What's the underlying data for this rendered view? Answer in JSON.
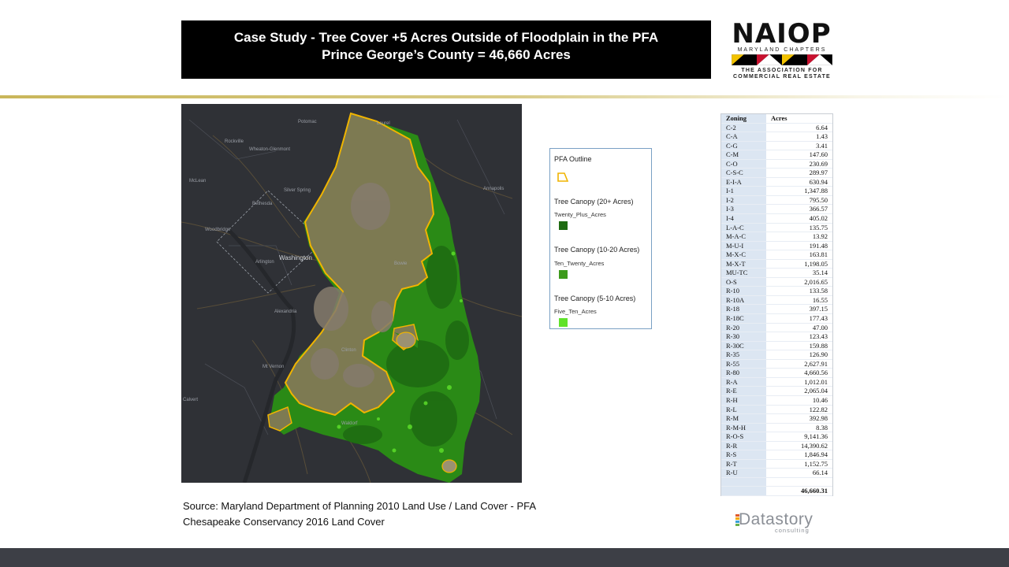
{
  "title": {
    "line1": "Case Study - Tree Cover +5 Acres Outside of Floodplain in the PFA",
    "line2": "Prince George’s County = 46,660 Acres"
  },
  "naiop_logo": {
    "name": "NAIOP",
    "chapter": "MARYLAND CHAPTERS",
    "tagline1": "THE ASSOCIATION FOR",
    "tagline2": "COMMERCIAL REAL ESTATE"
  },
  "map": {
    "labels": [
      "Washington",
      "Arlington",
      "Alexandria",
      "Bethesda",
      "Silver Spring",
      "Wheaton-Glenmont",
      "Rockville",
      "Laurel",
      "Bowie",
      "Annapolis",
      "Waldorf",
      "Clinton",
      "Mt Vernon",
      "Potomac",
      "McLean",
      "Woodbridge",
      "Calvert"
    ]
  },
  "legend": {
    "pfa_title": "PFA Outline",
    "groups": [
      {
        "heading": "Tree Canopy (20+ Acres)",
        "sub": "Twenty_Plus_Acres",
        "color": "#1e6b12"
      },
      {
        "heading": "Tree Canopy (10-20 Acres)",
        "sub": "Ten_Twenty_Acres",
        "color": "#3d9a1c"
      },
      {
        "heading": "Tree Canopy (5-10 Acres)",
        "sub": "Five_Ten_Acres",
        "color": "#5fe22a"
      }
    ],
    "pfa_outline_color": "#f0b400"
  },
  "table": {
    "headers": [
      "Zoning",
      "Acres"
    ],
    "rows": [
      {
        "zone": "C-2",
        "acres": "6.64"
      },
      {
        "zone": "C-A",
        "acres": "1.43"
      },
      {
        "zone": "C-G",
        "acres": "3.41"
      },
      {
        "zone": "C-M",
        "acres": "147.60"
      },
      {
        "zone": "C-O",
        "acres": "230.69"
      },
      {
        "zone": "C-S-C",
        "acres": "289.97"
      },
      {
        "zone": "E-I-A",
        "acres": "630.94"
      },
      {
        "zone": "I-1",
        "acres": "1,347.88"
      },
      {
        "zone": "I-2",
        "acres": "795.50"
      },
      {
        "zone": "I-3",
        "acres": "366.57"
      },
      {
        "zone": "I-4",
        "acres": "405.02"
      },
      {
        "zone": "L-A-C",
        "acres": "135.75"
      },
      {
        "zone": "M-A-C",
        "acres": "13.92"
      },
      {
        "zone": "M-U-I",
        "acres": "191.48"
      },
      {
        "zone": "M-X-C",
        "acres": "163.81"
      },
      {
        "zone": "M-X-T",
        "acres": "1,198.05"
      },
      {
        "zone": "MU-TC",
        "acres": "35.14"
      },
      {
        "zone": "O-S",
        "acres": "2,016.65"
      },
      {
        "zone": "R-10",
        "acres": "133.58"
      },
      {
        "zone": "R-10A",
        "acres": "16.55"
      },
      {
        "zone": "R-18",
        "acres": "397.15"
      },
      {
        "zone": "R-18C",
        "acres": "177.43"
      },
      {
        "zone": "R-20",
        "acres": "47.00"
      },
      {
        "zone": "R-30",
        "acres": "123.43"
      },
      {
        "zone": "R-30C",
        "acres": "159.88"
      },
      {
        "zone": "R-35",
        "acres": "126.90"
      },
      {
        "zone": "R-55",
        "acres": "2,627.91"
      },
      {
        "zone": "R-80",
        "acres": "4,660.56"
      },
      {
        "zone": "R-A",
        "acres": "1,012.01"
      },
      {
        "zone": "R-E",
        "acres": "2,065.04"
      },
      {
        "zone": "R-H",
        "acres": "10.46"
      },
      {
        "zone": "R-L",
        "acres": "122.82"
      },
      {
        "zone": "R-M",
        "acres": "392.98"
      },
      {
        "zone": "R-M-H",
        "acres": "8.38"
      },
      {
        "zone": "R-O-S",
        "acres": "9,141.36"
      },
      {
        "zone": "R-R",
        "acres": "14,390.62"
      },
      {
        "zone": "R-S",
        "acres": "1,846.94"
      },
      {
        "zone": "R-T",
        "acres": "1,152.75"
      },
      {
        "zone": "R-U",
        "acres": "66.14"
      },
      {
        "zone": "",
        "acres": ""
      }
    ],
    "total": "46,660.31"
  },
  "source": {
    "line1": "Source: Maryland Department of Planning 2010 Land Use / Land Cover - PFA",
    "line2": "Chesapeake Conservancy 2016 Land Cover"
  },
  "datastory": {
    "name": "Datastory",
    "sub": "consulting"
  }
}
